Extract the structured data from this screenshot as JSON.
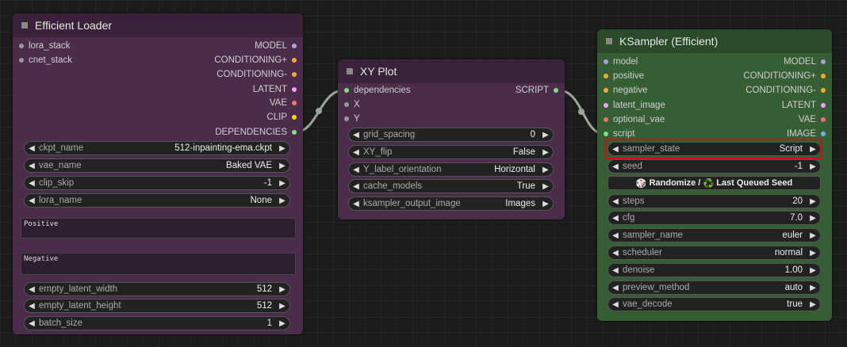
{
  "colors": {
    "purple_node": "#4b2d4b",
    "purple_title": "#3a233a",
    "green_node": "#355e35",
    "green_title": "#2a4a2a",
    "link": "#9aa69a",
    "model": "#b39ddb",
    "conditioning": "#ffa931",
    "latent": "#ff9cf9",
    "vae": "#ff6e6e",
    "clip": "#ffd500",
    "dependencies": "#7fe07f",
    "script": "#7fe07f",
    "image": "#64b5f6",
    "generic_input": "#999999"
  },
  "efficient_loader": {
    "title": "Efficient Loader",
    "inputs": [
      {
        "label": "lora_stack"
      },
      {
        "label": "cnet_stack"
      }
    ],
    "outputs": [
      {
        "label": "MODEL"
      },
      {
        "label": "CONDITIONING+"
      },
      {
        "label": "CONDITIONING-"
      },
      {
        "label": "LATENT"
      },
      {
        "label": "VAE"
      },
      {
        "label": "CLIP"
      },
      {
        "label": "DEPENDENCIES"
      }
    ],
    "widgets": [
      {
        "name": "ckpt_name",
        "value": "512-inpainting-ema.ckpt"
      },
      {
        "name": "vae_name",
        "value": "Baked VAE"
      },
      {
        "name": "clip_skip",
        "value": "-1"
      },
      {
        "name": "lora_name",
        "value": "None"
      }
    ],
    "positive_text": "Positive",
    "negative_text": "Negative",
    "widgets_bottom": [
      {
        "name": "empty_latent_width",
        "value": "512"
      },
      {
        "name": "empty_latent_height",
        "value": "512"
      },
      {
        "name": "batch_size",
        "value": "1"
      }
    ]
  },
  "xy_plot": {
    "title": "XY Plot",
    "inputs": [
      {
        "label": "dependencies"
      },
      {
        "label": "X"
      },
      {
        "label": "Y"
      }
    ],
    "output": {
      "label": "SCRIPT"
    },
    "widgets": [
      {
        "name": "grid_spacing",
        "value": "0"
      },
      {
        "name": "XY_flip",
        "value": "False"
      },
      {
        "name": "Y_label_orientation",
        "value": "Horizontal"
      },
      {
        "name": "cache_models",
        "value": "True"
      },
      {
        "name": "ksampler_output_image",
        "value": "Images"
      }
    ]
  },
  "ksampler": {
    "title": "KSampler (Efficient)",
    "inputs": [
      {
        "label": "model"
      },
      {
        "label": "positive"
      },
      {
        "label": "negative"
      },
      {
        "label": "latent_image"
      },
      {
        "label": "optional_vae"
      },
      {
        "label": "script"
      }
    ],
    "outputs": [
      {
        "label": "MODEL"
      },
      {
        "label": "CONDITIONING+"
      },
      {
        "label": "CONDITIONING-"
      },
      {
        "label": "LATENT"
      },
      {
        "label": "VAE"
      },
      {
        "label": "IMAGE"
      }
    ],
    "sampler_state": {
      "name": "sampler_state",
      "value": "Script"
    },
    "seed": {
      "name": "seed",
      "value": "-1"
    },
    "seed_button": {
      "icon1": "🎲",
      "text1": "Randomize /",
      "icon2": "♻️",
      "text2": "Last Queued Seed"
    },
    "widgets": [
      {
        "name": "steps",
        "value": "20"
      },
      {
        "name": "cfg",
        "value": "7.0"
      },
      {
        "name": "sampler_name",
        "value": "euler"
      },
      {
        "name": "scheduler",
        "value": "normal"
      },
      {
        "name": "denoise",
        "value": "1.00"
      },
      {
        "name": "preview_method",
        "value": "auto"
      },
      {
        "name": "vae_decode",
        "value": "true"
      }
    ]
  }
}
